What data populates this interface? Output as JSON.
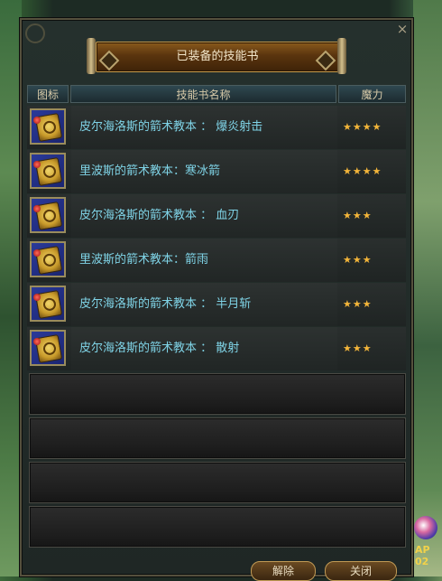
{
  "window": {
    "title": "已装备的技能书",
    "close_glyph": "×"
  },
  "table": {
    "headers": {
      "icon": "图标",
      "name": "技能书名称",
      "mana": "魔力"
    },
    "rows": [
      {
        "name": "皮尔海洛斯的箭术教本 ：  爆炎射击",
        "stars": "★★★★",
        "mana_level": 4,
        "icon": "skill-book-icon"
      },
      {
        "name": "里波斯的箭术教本：寒冰箭",
        "stars": "★★★★",
        "mana_level": 4,
        "icon": "skill-book-icon"
      },
      {
        "name": "皮尔海洛斯的箭术教本 ：  血刃",
        "stars": "★★★",
        "mana_level": 3,
        "icon": "skill-book-icon"
      },
      {
        "name": "里波斯的箭术教本：箭雨",
        "stars": "★★★",
        "mana_level": 3,
        "icon": "skill-book-icon"
      },
      {
        "name": "皮尔海洛斯的箭术教本 ：  半月斩",
        "stars": "★★★",
        "mana_level": 3,
        "icon": "skill-book-icon"
      },
      {
        "name": "皮尔海洛斯的箭术教本 ：  散射",
        "stars": "★★★",
        "mana_level": 3,
        "icon": "skill-book-icon"
      }
    ],
    "empty_slots": 4
  },
  "buttons": {
    "unequip": "解除",
    "close": "关闭"
  },
  "hud": {
    "ap_label": "AP 02"
  },
  "colors": {
    "name_text": "#7fd3e6",
    "stars": "#f3b53a",
    "title_text": "#f0e4c8",
    "header_text": "#d6c9a8"
  }
}
